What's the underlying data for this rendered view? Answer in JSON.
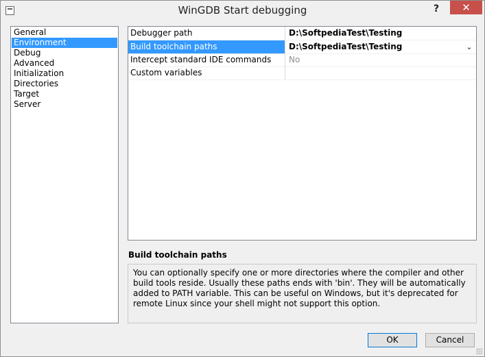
{
  "window": {
    "title": "WinGDB Start debugging",
    "help": "?",
    "close": "✕"
  },
  "nav": {
    "items": [
      {
        "label": "General",
        "selected": false
      },
      {
        "label": "Environment",
        "selected": true
      },
      {
        "label": "Debug",
        "selected": false
      },
      {
        "label": "Advanced",
        "selected": false
      },
      {
        "label": "Initialization",
        "selected": false
      },
      {
        "label": "Directories",
        "selected": false
      },
      {
        "label": "Target",
        "selected": false
      },
      {
        "label": "Server",
        "selected": false
      }
    ]
  },
  "grid": {
    "rows": [
      {
        "name": "Debugger path",
        "value": "D:\\SoftpediaTest\\Testing"
      },
      {
        "name": "Build toolchain paths",
        "value": "D:\\SoftpediaTest\\Testing"
      },
      {
        "name": "Intercept standard IDE commands",
        "value": "No"
      },
      {
        "name": "Custom variables",
        "value": ""
      }
    ],
    "dropdown_icon": "chevron-down"
  },
  "description": {
    "title": "Build toolchain paths",
    "text": "You can optionally specify one or more directories where the compiler and other build tools reside. Usually these paths ends with 'bin'. They will be automatically added to PATH variable. This can be useful on Windows, but it's deprecated for remote Linux since your shell might not support this option."
  },
  "buttons": {
    "ok": "OK",
    "cancel": "Cancel"
  },
  "colors": {
    "selection": "#3399ff",
    "close": "#c7504b"
  }
}
